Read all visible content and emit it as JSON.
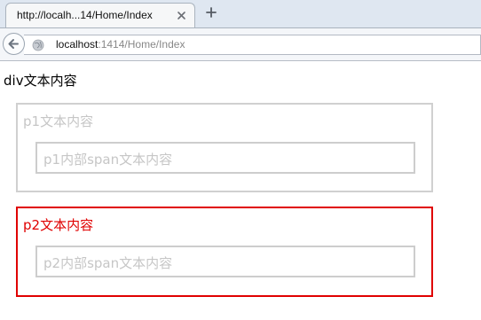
{
  "browser": {
    "tab_title": "http://localh...14/Home/Index",
    "url_host": "localhost",
    "url_rest": ":1414/Home/Index"
  },
  "page": {
    "div_text": "div文本内容",
    "p1": {
      "text": "p1文本内容",
      "span_text": "p1内部span文本内容"
    },
    "p2": {
      "text": "p2文本内容",
      "span_text": "p2内部span文本内容"
    }
  },
  "colors": {
    "p1_border": "#d0d0d0",
    "p2_border": "#e00000",
    "muted_text": "#c6c6c6",
    "accent_text": "#e00000"
  }
}
